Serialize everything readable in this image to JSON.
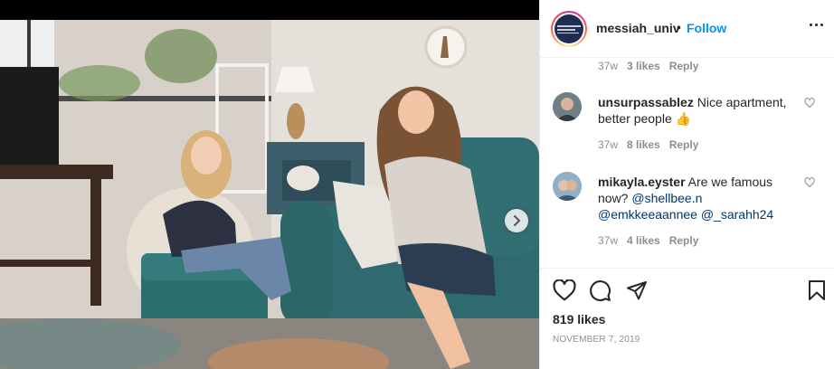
{
  "post": {
    "username": "messiah_univ",
    "separator": "•",
    "follow_label": "Follow",
    "likes": "819 likes",
    "date": "NOVEMBER 7, 2019",
    "carousel": {
      "slides": 3,
      "active": 1
    }
  },
  "comments": [
    {
      "user": "",
      "text": "",
      "time": "37w",
      "likes": "3 likes",
      "reply": "Reply"
    },
    {
      "user": "unsurpassablez",
      "text": "Nice apartment, better people 👍",
      "time": "37w",
      "likes": "8 likes",
      "reply": "Reply"
    },
    {
      "user": "mikayla.eyster",
      "text": "Are we famous now?",
      "mentions": [
        "@shellbee.n",
        "@emkkeeaannee",
        "@_sarahh24"
      ],
      "time": "37w",
      "likes": "4 likes",
      "reply": "Reply"
    }
  ],
  "icons": {
    "like": "heart-icon",
    "comment": "comment-icon",
    "share": "share-icon",
    "save": "bookmark-icon",
    "more": "more-options-icon",
    "next": "chevron-right-icon"
  },
  "colors": {
    "follow": "#0095f6",
    "muted": "#8e8e8e",
    "text": "#262626",
    "mention": "#00376b"
  }
}
